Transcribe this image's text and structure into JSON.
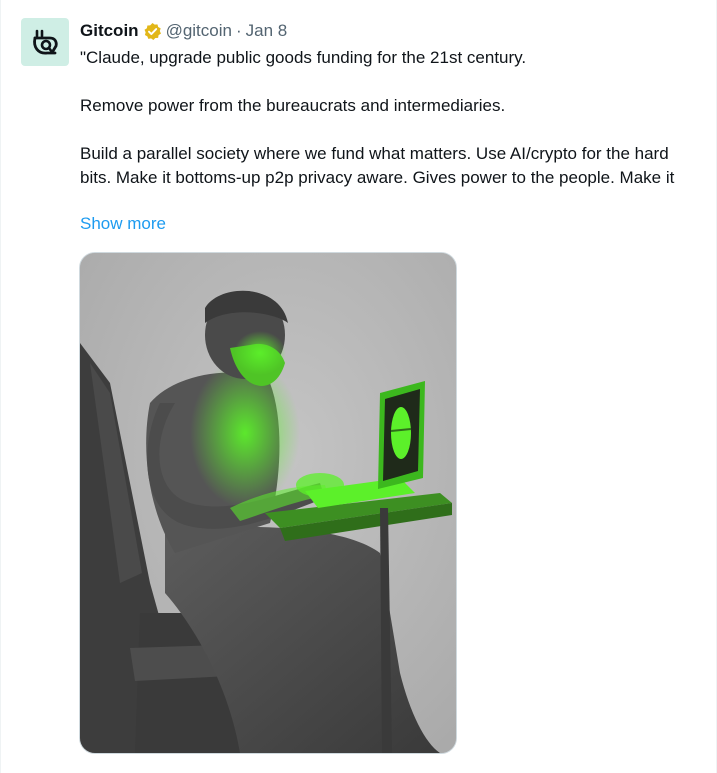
{
  "tweet": {
    "author_name": "Gitcoin",
    "handle": "@gitcoin",
    "separator": "·",
    "date": "Jan 8",
    "verified": true,
    "paragraphs": [
      "\"Claude, upgrade public goods funding for the 21st century.",
      "Remove power from the bureaucrats and intermediaries.",
      "Build a parallel society where we fund what matters. Use AI/crypto for the hard bits.  Make it bottoms-up p2p privacy aware.  Gives power to the people.  Make it"
    ],
    "show_more_label": "Show more"
  },
  "colors": {
    "link": "#1d9bf0",
    "muted": "#536471",
    "badge": "#e2b719",
    "avatar_bg": "#cfeee5",
    "image_glow": "#5cf02a"
  },
  "icons": {
    "avatar": "gitcoin-logo-icon",
    "badge": "verified-gold-badge-icon"
  }
}
